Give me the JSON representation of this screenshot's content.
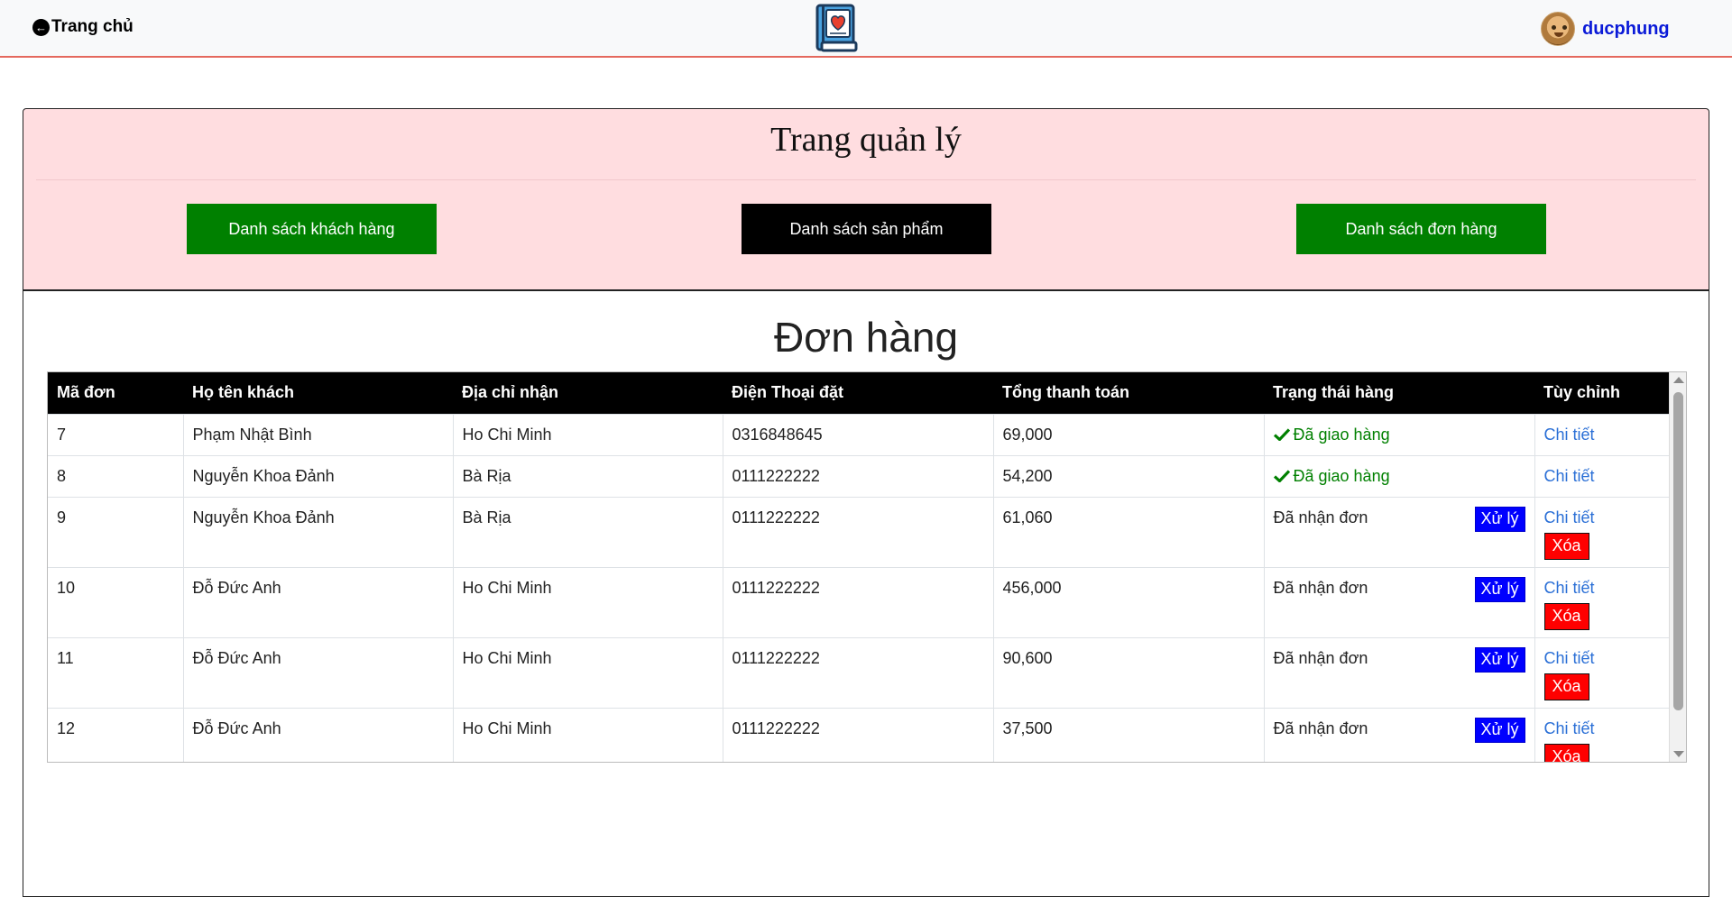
{
  "header": {
    "home_label": "Trang chủ",
    "username": "ducphung"
  },
  "admin": {
    "title": "Trang quản lý",
    "buttons": {
      "customers": "Danh sách khách hàng",
      "products": "Danh sách sản phẩm",
      "orders": "Danh sách đơn hàng"
    }
  },
  "orders": {
    "title": "Đơn hàng",
    "columns": [
      "Mã đơn",
      "Họ tên khách",
      "Địa chỉ nhận",
      "Điện Thoại đặt",
      "Tổng thanh toán",
      "Trạng thái hàng",
      "Tùy chỉnh"
    ],
    "actions": {
      "detail": "Chi tiết",
      "process": "Xử lý",
      "delete": "Xóa"
    },
    "rows": [
      {
        "id": "7",
        "name": "Phạm Nhật Bình",
        "address": "Ho Chi Minh",
        "phone": "0316848645",
        "total": "69,000",
        "status": "Đã giao hàng"
      },
      {
        "id": "8",
        "name": "Nguyễn Khoa Đảnh",
        "address": "Bà Rịa",
        "phone": "0111222222",
        "total": "54,200",
        "status": "Đã giao hàng"
      },
      {
        "id": "9",
        "name": "Nguyễn Khoa Đảnh",
        "address": "Bà Rịa",
        "phone": "0111222222",
        "total": "61,060",
        "status": "Đã nhận đơn"
      },
      {
        "id": "10",
        "name": "Đỗ Đức Anh",
        "address": "Ho Chi Minh",
        "phone": "0111222222",
        "total": "456,000",
        "status": "Đã nhận đơn"
      },
      {
        "id": "11",
        "name": "Đỗ Đức Anh",
        "address": "Ho Chi Minh",
        "phone": "0111222222",
        "total": "90,600",
        "status": "Đã nhận đơn"
      },
      {
        "id": "12",
        "name": "Đỗ Đức Anh",
        "address": "Ho Chi Minh",
        "phone": "0111222222",
        "total": "37,500",
        "status": "Đã nhận đơn"
      }
    ]
  },
  "colors": {
    "accent_line": "#e4685d",
    "green_button": "#008000",
    "process_button": "#0000ff",
    "delete_button": "#ff0000",
    "admin_bg": "#ffdde0"
  },
  "icons": {
    "home": "arrow-circle-left-icon",
    "logo": "book-heart-icon",
    "delivered": "check-icon"
  }
}
